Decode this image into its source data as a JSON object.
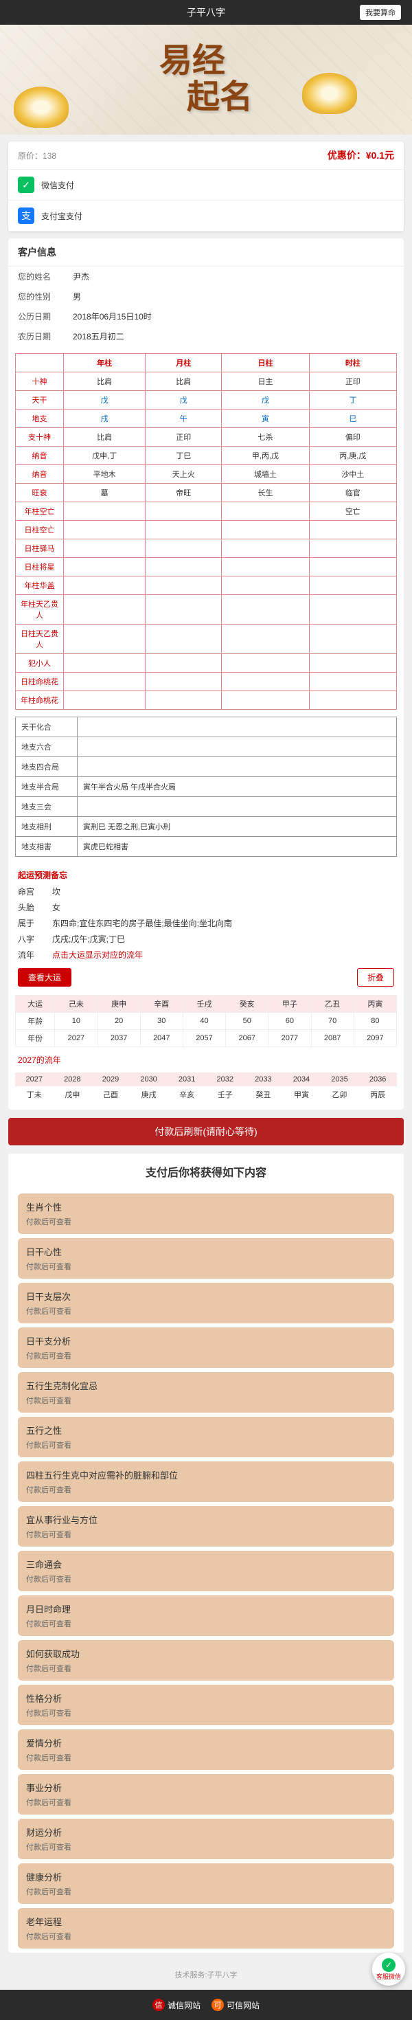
{
  "topbar": {
    "title": "子平八字",
    "btn": "我要算命"
  },
  "banner": {
    "line1": "易经",
    "line2": "起名"
  },
  "price": {
    "orig_label": "原价：",
    "orig": "138",
    "promo_label": "优惠价：",
    "promo": "¥0.1元"
  },
  "payments": [
    {
      "icon": "wechat",
      "label": "微信支付"
    },
    {
      "icon": "alipay",
      "label": "支付宝支付"
    }
  ],
  "customer": {
    "title": "客户信息",
    "rows": [
      {
        "lbl": "您的姓名",
        "val": "尹杰"
      },
      {
        "lbl": "您的性别",
        "val": "男"
      },
      {
        "lbl": "公历日期",
        "val": "2018年06月15日10时"
      },
      {
        "lbl": "农历日期",
        "val": "2018五月初二"
      }
    ]
  },
  "bazi": {
    "head": [
      "",
      "年柱",
      "月柱",
      "日柱",
      "时柱"
    ],
    "rows": [
      {
        "th": "十神",
        "cells": [
          "比肩",
          "比肩",
          "日主",
          "正印"
        ],
        "cls": ""
      },
      {
        "th": "天干",
        "cells": [
          "戊",
          "戊",
          "戊",
          "丁"
        ],
        "cls": "blue"
      },
      {
        "th": "地支",
        "cells": [
          "戌",
          "午",
          "寅",
          "巳"
        ],
        "cls": "blue"
      },
      {
        "th": "支十神",
        "cells": [
          "比肩",
          "正印",
          "七杀",
          "偏印"
        ],
        "cls": ""
      },
      {
        "th": "纳音",
        "cells": [
          "戊申,丁",
          "丁巳",
          "甲,丙,戊",
          "丙,庚,戊"
        ],
        "cls": ""
      },
      {
        "th": "纳音",
        "cells": [
          "平地木",
          "天上火",
          "城墙土",
          "沙中土"
        ],
        "cls": ""
      },
      {
        "th": "旺衰",
        "cells": [
          "墓",
          "帝旺",
          "长生",
          "临官"
        ],
        "cls": ""
      },
      {
        "th": "年柱空亡",
        "cells": [
          "",
          "",
          "",
          "空亡"
        ],
        "cls": ""
      },
      {
        "th": "日柱空亡",
        "cells": [
          "",
          "",
          "",
          ""
        ],
        "cls": ""
      },
      {
        "th": "日柱驿马",
        "cells": [
          "",
          "",
          "",
          ""
        ],
        "cls": ""
      },
      {
        "th": "日柱将星",
        "cells": [
          "",
          "",
          "",
          ""
        ],
        "cls": ""
      },
      {
        "th": "年柱华盖",
        "cells": [
          "",
          "",
          "",
          ""
        ],
        "cls": ""
      },
      {
        "th": "年柱天乙贵人",
        "cells": [
          "",
          "",
          "",
          ""
        ],
        "cls": ""
      },
      {
        "th": "日柱天乙贵人",
        "cells": [
          "",
          "",
          "",
          ""
        ],
        "cls": ""
      },
      {
        "th": "犯小人",
        "cells": [
          "",
          "",
          "",
          ""
        ],
        "cls": ""
      },
      {
        "th": "日柱命桃花",
        "cells": [
          "",
          "",
          "",
          ""
        ],
        "cls": ""
      },
      {
        "th": "年柱命桃花",
        "cells": [
          "",
          "",
          "",
          ""
        ],
        "cls": ""
      }
    ]
  },
  "info2": [
    {
      "lbl": "天干化合",
      "val": ""
    },
    {
      "lbl": "地支六合",
      "val": ""
    },
    {
      "lbl": "地支四合局",
      "val": ""
    },
    {
      "lbl": "地支半合局",
      "val": "寅午半合火局 午戌半合火局"
    },
    {
      "lbl": "地支三会",
      "val": ""
    },
    {
      "lbl": "地支相刑",
      "val": "寅刑巳 无恩之刑,巳寅小刑"
    },
    {
      "lbl": "地支相害",
      "val": "寅虎巳蛇相害"
    }
  ],
  "advice": {
    "title": "起运预测备忘",
    "rows": [
      {
        "lbl": "命宫",
        "val": "坎"
      },
      {
        "lbl": "头胎",
        "val": "女"
      },
      {
        "lbl": "属于",
        "val": "东四命;宜住东四宅的房子最佳;最佳坐向;坐北向南"
      },
      {
        "lbl": "八字",
        "val": "戊戌;戊午;戊寅;丁巳"
      },
      {
        "lbl": "流年",
        "val": "点击大运显示对应的流年",
        "red": true
      }
    ]
  },
  "dayun": {
    "expand": "查看大运",
    "collapse": "折叠",
    "rows": [
      [
        "大运",
        "己未",
        "庚申",
        "辛酉",
        "壬戌",
        "癸亥",
        "甲子",
        "乙丑",
        "丙寅"
      ],
      [
        "年龄",
        "10",
        "20",
        "30",
        "40",
        "50",
        "60",
        "70",
        "80"
      ],
      [
        "年份",
        "2027",
        "2037",
        "2047",
        "2057",
        "2067",
        "2077",
        "2087",
        "2097"
      ]
    ]
  },
  "liunian": {
    "title": "2027的流年",
    "rows": [
      [
        "2027",
        "2028",
        "2029",
        "2030",
        "2031",
        "2032",
        "2033",
        "2034",
        "2035",
        "2036"
      ],
      [
        "丁未",
        "戊申",
        "己酉",
        "庚戌",
        "辛亥",
        "壬子",
        "癸丑",
        "甲寅",
        "乙卯",
        "丙辰"
      ]
    ]
  },
  "payBtn": "付款后刷新(请耐心等待)",
  "unlock": {
    "title": "支付后你将获得如下内容",
    "sub": "付款后可查看",
    "items": [
      "生肖个性",
      "日干心性",
      "日干支层次",
      "日干支分析",
      "五行生克制化宜忌",
      "五行之性",
      "四柱五行生克中对应需补的脏腑和部位",
      "宜从事行业与方位",
      "三命通会",
      "月日时命理",
      "如何获取成功",
      "性格分析",
      "爱情分析",
      "事业分析",
      "财运分析",
      "健康分析",
      "老年运程"
    ]
  },
  "footer": {
    "note": "技术服务:子平八字",
    "badges": [
      {
        "icon": "信",
        "text": "诚信网站",
        "c": "r"
      },
      {
        "icon": "可",
        "text": "可信网站",
        "c": "o"
      }
    ],
    "contact": "客服微信"
  }
}
